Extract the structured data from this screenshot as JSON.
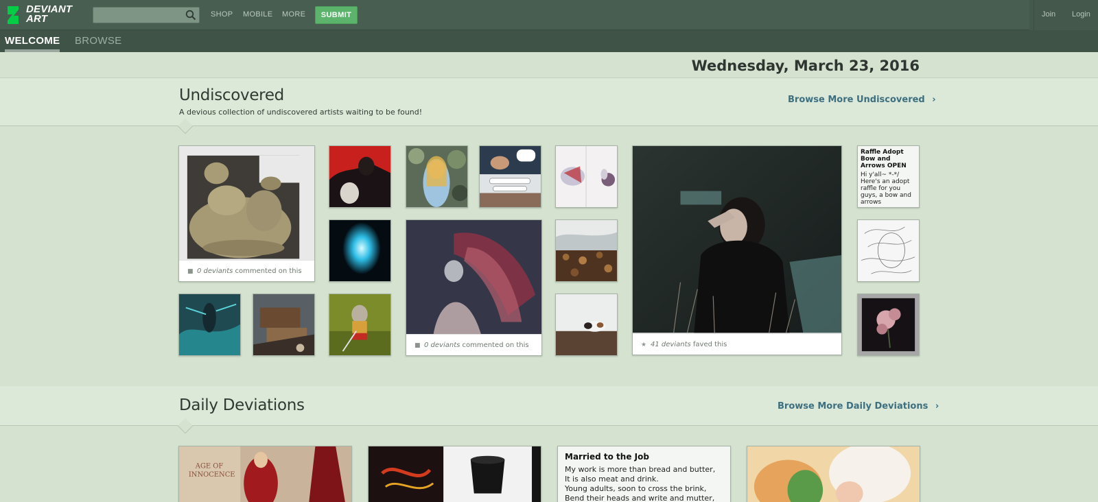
{
  "header": {
    "logo_text": "DEVIANT ART",
    "search": {
      "value": "",
      "placeholder": ""
    },
    "nav": {
      "shop": "SHOP",
      "mobile": "MOBILE",
      "more": "MORE"
    },
    "submit_label": "SUBMIT",
    "join_label": "Join",
    "login_label": "Login"
  },
  "tabs": {
    "welcome": "WELCOME",
    "browse": "BROWSE"
  },
  "date": "Wednesday, March 23, 2016",
  "undiscovered": {
    "title": "Undiscovered",
    "subtitle": "A devious collection of undiscovered artists waiting to be found!",
    "browse_more": "Browse More Undiscovered",
    "card1_count": "0 deviants",
    "card1_action": "commented on this",
    "card2_count": "0 deviants",
    "card2_action": "commented on this",
    "card3_count": "41 deviants",
    "card3_action": "faved this",
    "lit_title": "Raffle Adopt Bow and Arrows OPEN",
    "lit_body": "Hi y'all~ *-*/\nHere's an adopt raffle for you guys, a bow and arrows"
  },
  "daily": {
    "title": "Daily Deviations",
    "browse_more": "Browse More Daily Deviations",
    "lit_title": "Married to the Job",
    "lit_body": "My work is more than bread and butter,\nIt is also meat and drink.\nYoung adults, soon to cross the brink,\nBend their heads and write and mutter,\nTo please or quiet me, they utter"
  },
  "icons": {
    "search": "search-icon",
    "chevron": "chevron-right-icon",
    "comment": "comment-icon",
    "star": "star-icon",
    "logo": "deviantart-logo-icon"
  },
  "colors": {
    "topbar": "#485e50",
    "submit": "#5cb36b",
    "link": "#3c6f7f",
    "page_bg": "#d4e2cf"
  }
}
